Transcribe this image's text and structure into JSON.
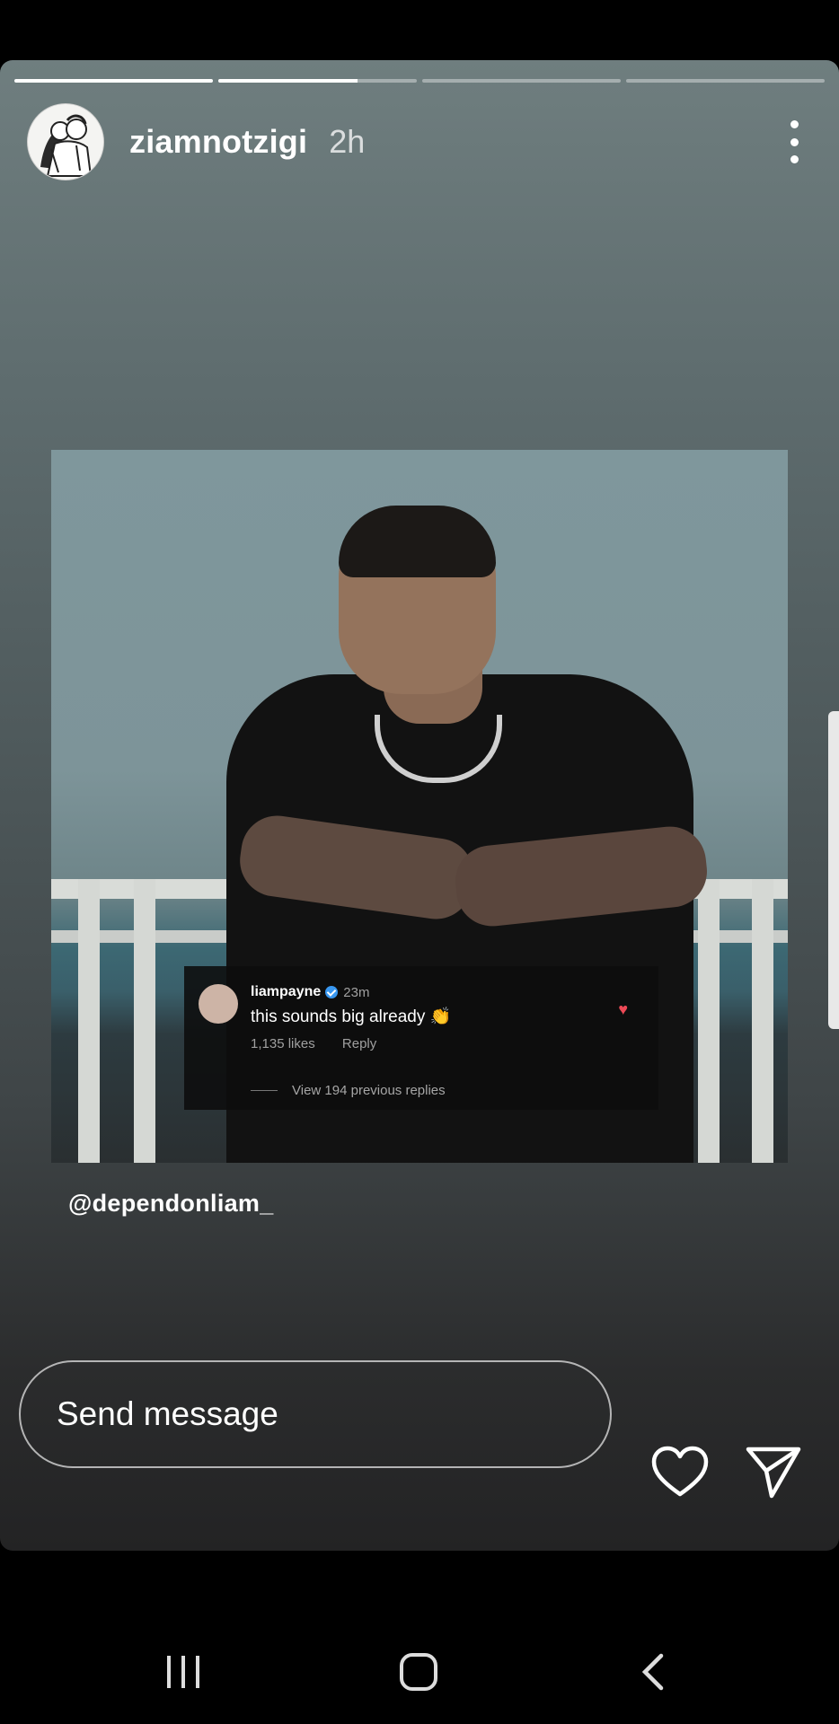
{
  "story": {
    "progress": [
      1.0,
      0.7,
      0.0,
      0.0
    ],
    "username": "ziamnotzigi",
    "time": "2h",
    "mention": "@dependonliam_"
  },
  "comment": {
    "username": "liampayne",
    "time": "23m",
    "text": "this sounds big already 👏",
    "likes": "1,135 likes",
    "reply": "Reply",
    "view_replies": "View 194 previous replies"
  },
  "reply_bar": {
    "placeholder": "Send message"
  },
  "icons": {
    "more": "more-vertical-icon",
    "like": "heart-icon",
    "share": "send-icon",
    "nav_recents": "recents-icon",
    "nav_home": "home-icon",
    "nav_back": "back-icon"
  },
  "colors": {
    "verified": "#3897f0",
    "heart_red": "#ed4956"
  }
}
